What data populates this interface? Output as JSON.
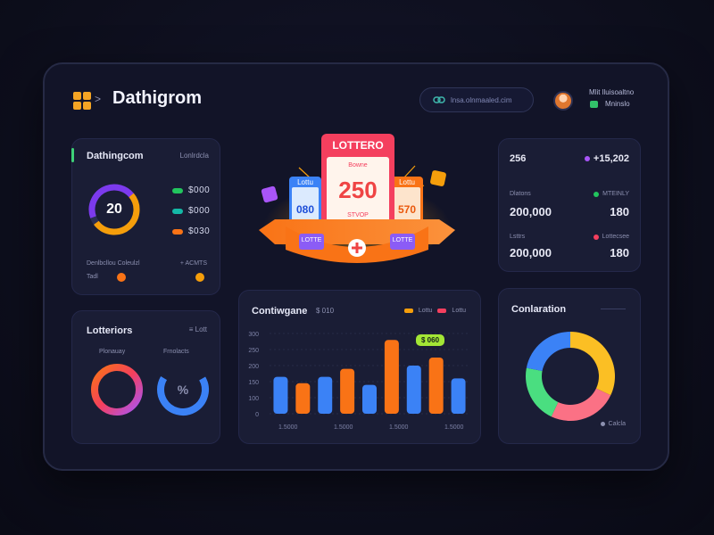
{
  "header": {
    "brand": "Dathigrom",
    "crumb_separator": ">",
    "search_placeholder": "lnsa.olnmaaled.cim",
    "user_name": "Mlit lluisoaltno",
    "user_status": "Mninslo"
  },
  "overview": {
    "title": "Dathingcom",
    "subtitle": "Lonlrdcla",
    "donut_value": "20",
    "legend": [
      "$000",
      "$000",
      "$030"
    ],
    "footer_left": "Denlbcllou Coleulzl",
    "footer_right": "+ ACMTS",
    "footer_small": "Tadl"
  },
  "lottery": {
    "header": "LOTTERO",
    "sub": "Bowne",
    "main_value": "250",
    "main_sub": "STVOP",
    "left_ticket_label": "Lottu",
    "left_ticket_value": "080",
    "right_ticket_label": "Lottu",
    "right_ticket_value": "570",
    "ribbon_left": "LOTTE",
    "ribbon_right": "LOTTE"
  },
  "stats": {
    "top_left": "256",
    "top_right": "+15,202",
    "row1_label": "Dlatons",
    "row1_badge": "MTEINLY",
    "row1_value_left": "200,000",
    "row1_value_right": "180",
    "row2_label": "Lsttrs",
    "row2_badge": "Lottecsee",
    "row2_value_left": "200,000",
    "row2_value_right": "180"
  },
  "lotteries": {
    "title": "Lotteriors",
    "badge": "≡ Lott",
    "ring1_label": "Plonauay",
    "ring2_label": "Frnolacts"
  },
  "bar_chart": {
    "title": "Contiwgane",
    "subtitle": "$ 010",
    "legend": [
      "Lottu",
      "Lottu"
    ],
    "tooltip": "$ 060",
    "y_ticks": [
      "300",
      "250",
      "200",
      "150",
      "100",
      "0"
    ],
    "x_ticks": [
      "1.5000",
      "1.5000",
      "1.5000",
      "1.5000"
    ]
  },
  "chart_data": {
    "type": "bar",
    "categories": [
      "1",
      "2",
      "3",
      "4",
      "5",
      "6",
      "7",
      "8",
      "9"
    ],
    "series": [
      {
        "values": [
          230,
          190,
          230,
          280,
          180,
          460,
          300,
          350,
          220
        ]
      }
    ],
    "ylim": [
      0,
      500
    ]
  },
  "donut": {
    "title": "Conlaration",
    "footer": "Calcla",
    "segments": [
      32,
      25,
      21,
      22
    ],
    "colors": [
      "#fbbf24",
      "#fb7185",
      "#4ade80",
      "#3b82f6"
    ]
  },
  "colors": {
    "accent_orange": "#f59e0b",
    "accent_blue": "#3b82f6",
    "accent_green": "#3ed178",
    "accent_pink": "#f43f5e"
  }
}
